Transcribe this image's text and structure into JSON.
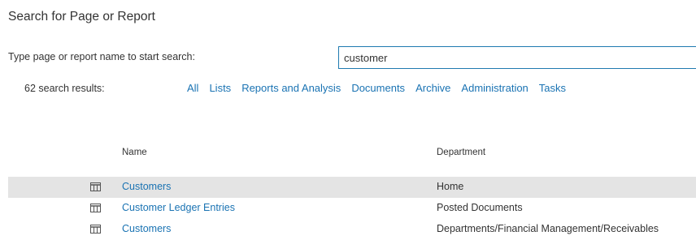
{
  "page": {
    "title": "Search for Page or Report",
    "prompt": "Type page or report name to start search:",
    "search_value": "customer",
    "results_count": "62 search results:"
  },
  "filters": [
    "All",
    "Lists",
    "Reports and Analysis",
    "Documents",
    "Archive",
    "Administration",
    "Tasks"
  ],
  "table": {
    "headers": {
      "name": "Name",
      "department": "Department"
    },
    "rows": [
      {
        "name": "Customers",
        "department": "Home",
        "icon": "list-page-icon",
        "selected": true
      },
      {
        "name": "Customer Ledger Entries",
        "department": "Posted Documents",
        "icon": "list-page-icon",
        "selected": false
      },
      {
        "name": "Customers",
        "department": "Departments/Financial Management/Receivables",
        "icon": "list-page-icon",
        "selected": false
      }
    ]
  },
  "colors": {
    "link": "#1a73b3",
    "selected_row": "#e4e4e4",
    "input_border": "#1f7ab0"
  }
}
